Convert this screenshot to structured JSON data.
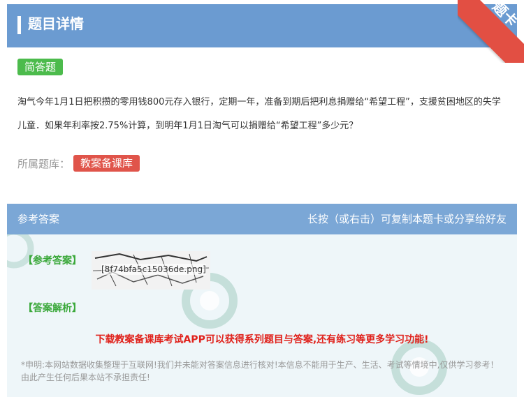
{
  "header": {
    "title": "题目详情",
    "corner_label": "题卡"
  },
  "question": {
    "type_tag": "简答题",
    "text": "淘气今年1月1日把积攒的零用钱800元存入银行，定期一年，准备到期后把利息捐赠给“希望工程”，支援贫困地区的失学儿童．如果年利率按2.75%计算，到明年1月1日淘气可以捐赠给“希望工程”多少元？",
    "bank_label": "所属题库：",
    "bank_name": "教案备课库"
  },
  "answer": {
    "section_title": "参考答案",
    "share_hint": "长按（或右击）可复制本题卡或分享给好友",
    "answer_label": "【参考答案】",
    "answer_image_name": "[8f74bfa5c15036de.png]",
    "analysis_label": "【答案解析】",
    "promo": "下载教案备课库考试APP可以获得系列题目与答案,还有练习等更多学习功能!",
    "disclaimer": "*申明:本网站数据收集整理于互联网!我们并未能对答案信息进行核对!本信息不能用于生产、生活、考试等情境中,仅供学习参考！由此产生任何后果本站不承担责任!"
  },
  "colors": {
    "header_blue": "#6b9bd1",
    "answer_blue": "#7ba7d6",
    "green": "#4cbb4c",
    "red": "#e0544a",
    "promo_red": "#e0221c"
  }
}
